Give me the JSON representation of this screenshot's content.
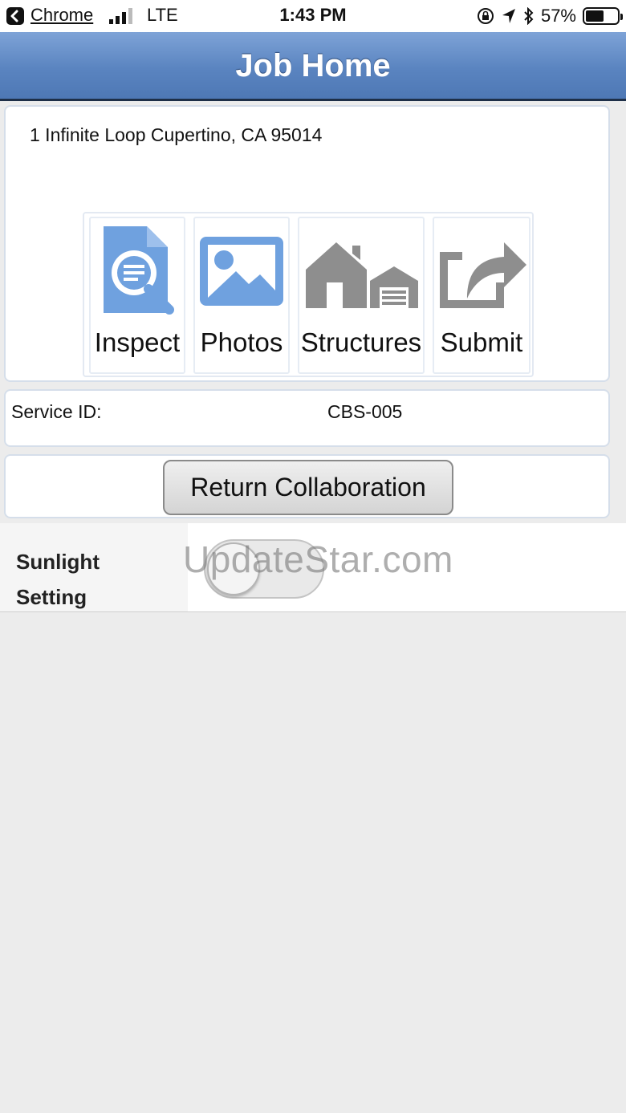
{
  "status_bar": {
    "back_app": "Chrome",
    "carrier": "LTE",
    "time": "1:43 PM",
    "battery_percent": "57%",
    "battery_level": 0.57,
    "icons": [
      "back-arrow-icon",
      "signal-bars-icon",
      "orientation-lock-icon",
      "location-arrow-icon",
      "bluetooth-icon",
      "battery-icon"
    ]
  },
  "header": {
    "title": "Job Home"
  },
  "job": {
    "address": "1 Infinite Loop Cupertino, CA 95014"
  },
  "tools": [
    {
      "label": "Inspect",
      "icon": "document-search-icon",
      "color": "#6fa1df"
    },
    {
      "label": "Photos",
      "icon": "image-icon",
      "color": "#6fa1df"
    },
    {
      "label": "Structures",
      "icon": "house-garage-icon",
      "color": "#8e8e8e"
    },
    {
      "label": "Submit",
      "icon": "share-export-icon",
      "color": "#8e8e8e"
    }
  ],
  "service": {
    "label": "Service ID:",
    "value": "CBS-005"
  },
  "actions": {
    "return_label": "Return Collaboration"
  },
  "settings": {
    "sunlight_label_line1": "Sunlight",
    "sunlight_label_line2": "Setting",
    "sunlight_on": false
  },
  "watermark": "UpdateStar.com",
  "colors": {
    "header_top": "#7ea3d7",
    "header_bottom": "#4e78b5",
    "background": "#ececec",
    "card_border": "#d5deea"
  }
}
